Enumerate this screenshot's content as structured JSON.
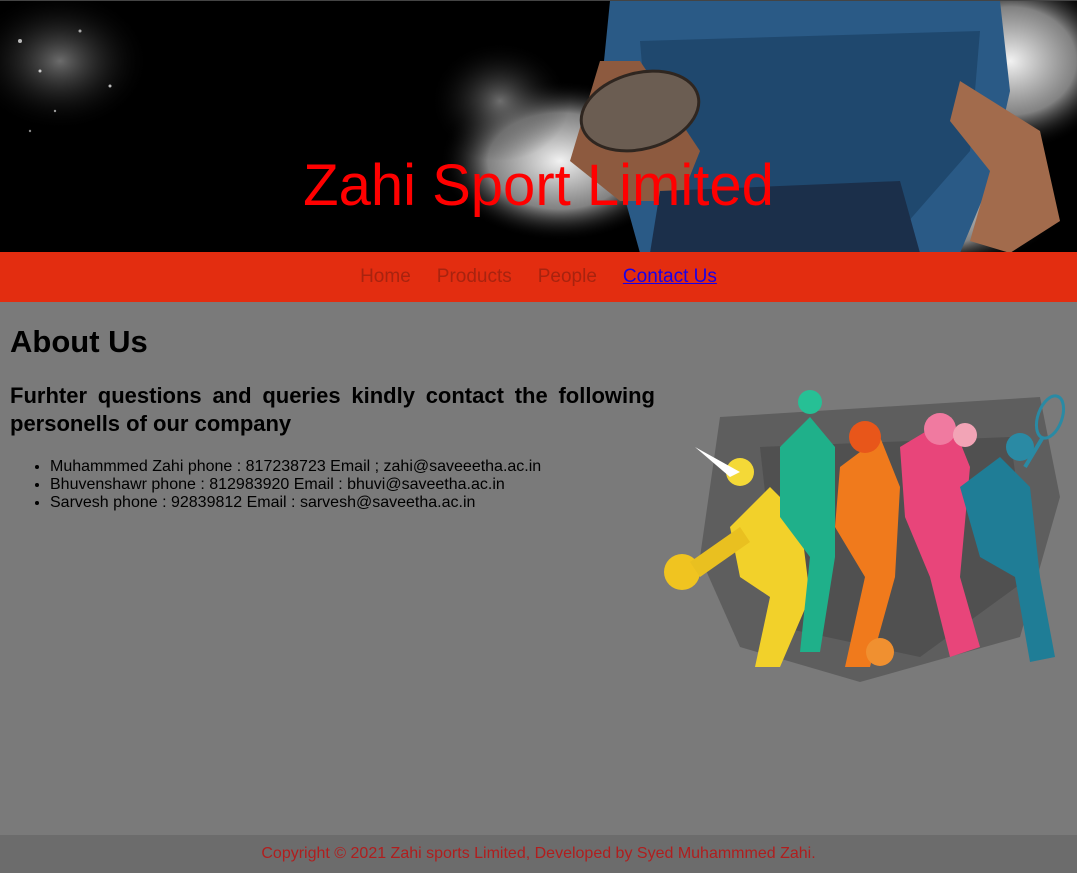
{
  "header": {
    "title": "Zahi Sport Limited"
  },
  "nav": {
    "items": [
      {
        "label": "Home",
        "active": false
      },
      {
        "label": "Products",
        "active": false
      },
      {
        "label": "People",
        "active": false
      },
      {
        "label": "Contact Us",
        "active": true
      }
    ]
  },
  "about": {
    "heading": "About Us",
    "subheading": "Furhter questions and queries kindly contact the following personells of our company",
    "contacts": [
      "Muhammmed Zahi phone : 817238723 Email ; zahi@saveeetha.ac.in",
      "Bhuvenshawr phone : 812983920 Email : bhuvi@saveetha.ac.in",
      "Sarvesh phone : 92839812 Email : sarvesh@saveetha.ac.in"
    ]
  },
  "footer": {
    "text": "Copyright © 2021 Zahi sports Limited, Developed by Syed Muhammmed Zahi."
  },
  "colors": {
    "nav_bg": "#e32d10",
    "page_bg": "#7a7a7a",
    "title_red": "#ff0000",
    "active_link": "#1a00e8"
  }
}
